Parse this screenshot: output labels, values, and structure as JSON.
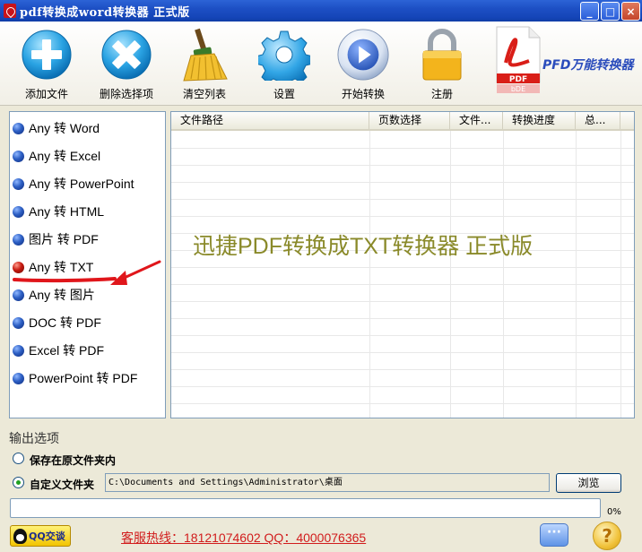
{
  "window": {
    "title": "pdf转换成word转换器 正式版",
    "buttons": [
      "_",
      "□",
      "×"
    ]
  },
  "toolbar": {
    "items": [
      {
        "label": "添加文件",
        "icon": "plus-icon",
        "color": "#2aa3e3"
      },
      {
        "label": "删除选择项",
        "icon": "cross-icon",
        "color": "#2aa3e3"
      },
      {
        "label": "清空列表",
        "icon": "broom-icon",
        "color": "#e5b21d"
      },
      {
        "label": "设置",
        "icon": "gear-icon",
        "color": "#2aa3e3"
      },
      {
        "label": "开始转换",
        "icon": "play-icon",
        "color": "#3f78c9"
      },
      {
        "label": "注册",
        "icon": "lock-icon",
        "color": "#f0b21a"
      }
    ],
    "brand_text": "PFD万能转换器",
    "brand_logo_text": "PDF",
    "brand_logo_text2": "bDE"
  },
  "conversion_list": {
    "items": [
      {
        "label": "Any 转 Word",
        "selected": false
      },
      {
        "label": "Any 转 Excel",
        "selected": false
      },
      {
        "label": "Any 转 PowerPoint",
        "selected": false
      },
      {
        "label": "Any 转 HTML",
        "selected": false
      },
      {
        "label": "图片 转 PDF",
        "selected": false
      },
      {
        "label": "Any 转 TXT",
        "selected": true
      },
      {
        "label": "Any 转 图片",
        "selected": false
      },
      {
        "label": "DOC 转 PDF",
        "selected": false
      },
      {
        "label": "Excel 转 PDF",
        "selected": false
      },
      {
        "label": "PowerPoint 转 PDF",
        "selected": false
      }
    ]
  },
  "file_table": {
    "columns": [
      "文件路径",
      "页数选择",
      "文件...",
      "转换进度",
      "总..."
    ],
    "rows": [],
    "watermark": "迅捷PDF转换成TXT转换器 正式版"
  },
  "output": {
    "section_label": "输出选项",
    "option_original": "保存在原文件夹内",
    "option_custom": "自定义文件夹",
    "selected_option": "custom",
    "path": "C:\\Documents and Settings\\Administrator\\桌面",
    "browse_label": "浏览",
    "progress_value": 0,
    "progress_text": "0%"
  },
  "footer": {
    "qq_label": "QQ交谈",
    "hotline": "客服热线：18121074602 QQ：4000076365",
    "chat_icon": "chat-bubble-icon",
    "help_icon": "help-icon",
    "help_text": "?",
    "chat_text": "···"
  },
  "colors": {
    "titlebar": "#1d4fc4",
    "accent_red": "#d11c1c",
    "watermark": "#8a8a2a",
    "brand_blue": "#2b4dbc"
  }
}
